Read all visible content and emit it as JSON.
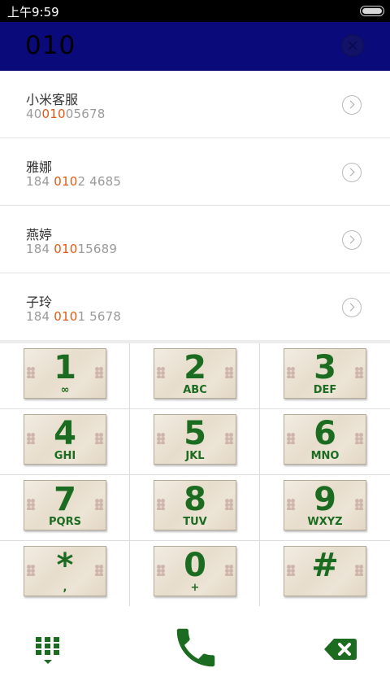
{
  "status_bar": {
    "time": "上午9:59"
  },
  "search": {
    "query": "010"
  },
  "contacts": [
    {
      "name": "小米客服",
      "number_pre": "40",
      "number_match": "010",
      "number_post": "05678"
    },
    {
      "name": "雅娜",
      "number_pre": "184 ",
      "number_match": "010",
      "number_post": "2 4685"
    },
    {
      "name": "燕婷",
      "number_pre": "184 ",
      "number_match": "010",
      "number_post": "15689"
    },
    {
      "name": "子玲",
      "number_pre": "184 ",
      "number_match": "010",
      "number_post": "1 5678"
    }
  ],
  "keypad": [
    {
      "digit": "1",
      "letters": "∞"
    },
    {
      "digit": "2",
      "letters": "ABC"
    },
    {
      "digit": "3",
      "letters": "DEF"
    },
    {
      "digit": "4",
      "letters": "GHI"
    },
    {
      "digit": "5",
      "letters": "JKL"
    },
    {
      "digit": "6",
      "letters": "MNO"
    },
    {
      "digit": "7",
      "letters": "PQRS"
    },
    {
      "digit": "8",
      "letters": "TUV"
    },
    {
      "digit": "9",
      "letters": "WXYZ"
    },
    {
      "digit": "*",
      "letters": ","
    },
    {
      "digit": "0",
      "letters": "+"
    },
    {
      "digit": "#",
      "letters": ""
    }
  ],
  "colors": {
    "header": "#0a0a7a",
    "accent_green": "#1b6b20",
    "highlight": "#e05a14"
  },
  "icons": {
    "keypad_toggle": "dialpad-icon",
    "call": "phone-icon",
    "delete": "backspace-icon",
    "clear": "clear-icon",
    "detail": "chevron-right-circle-icon"
  }
}
